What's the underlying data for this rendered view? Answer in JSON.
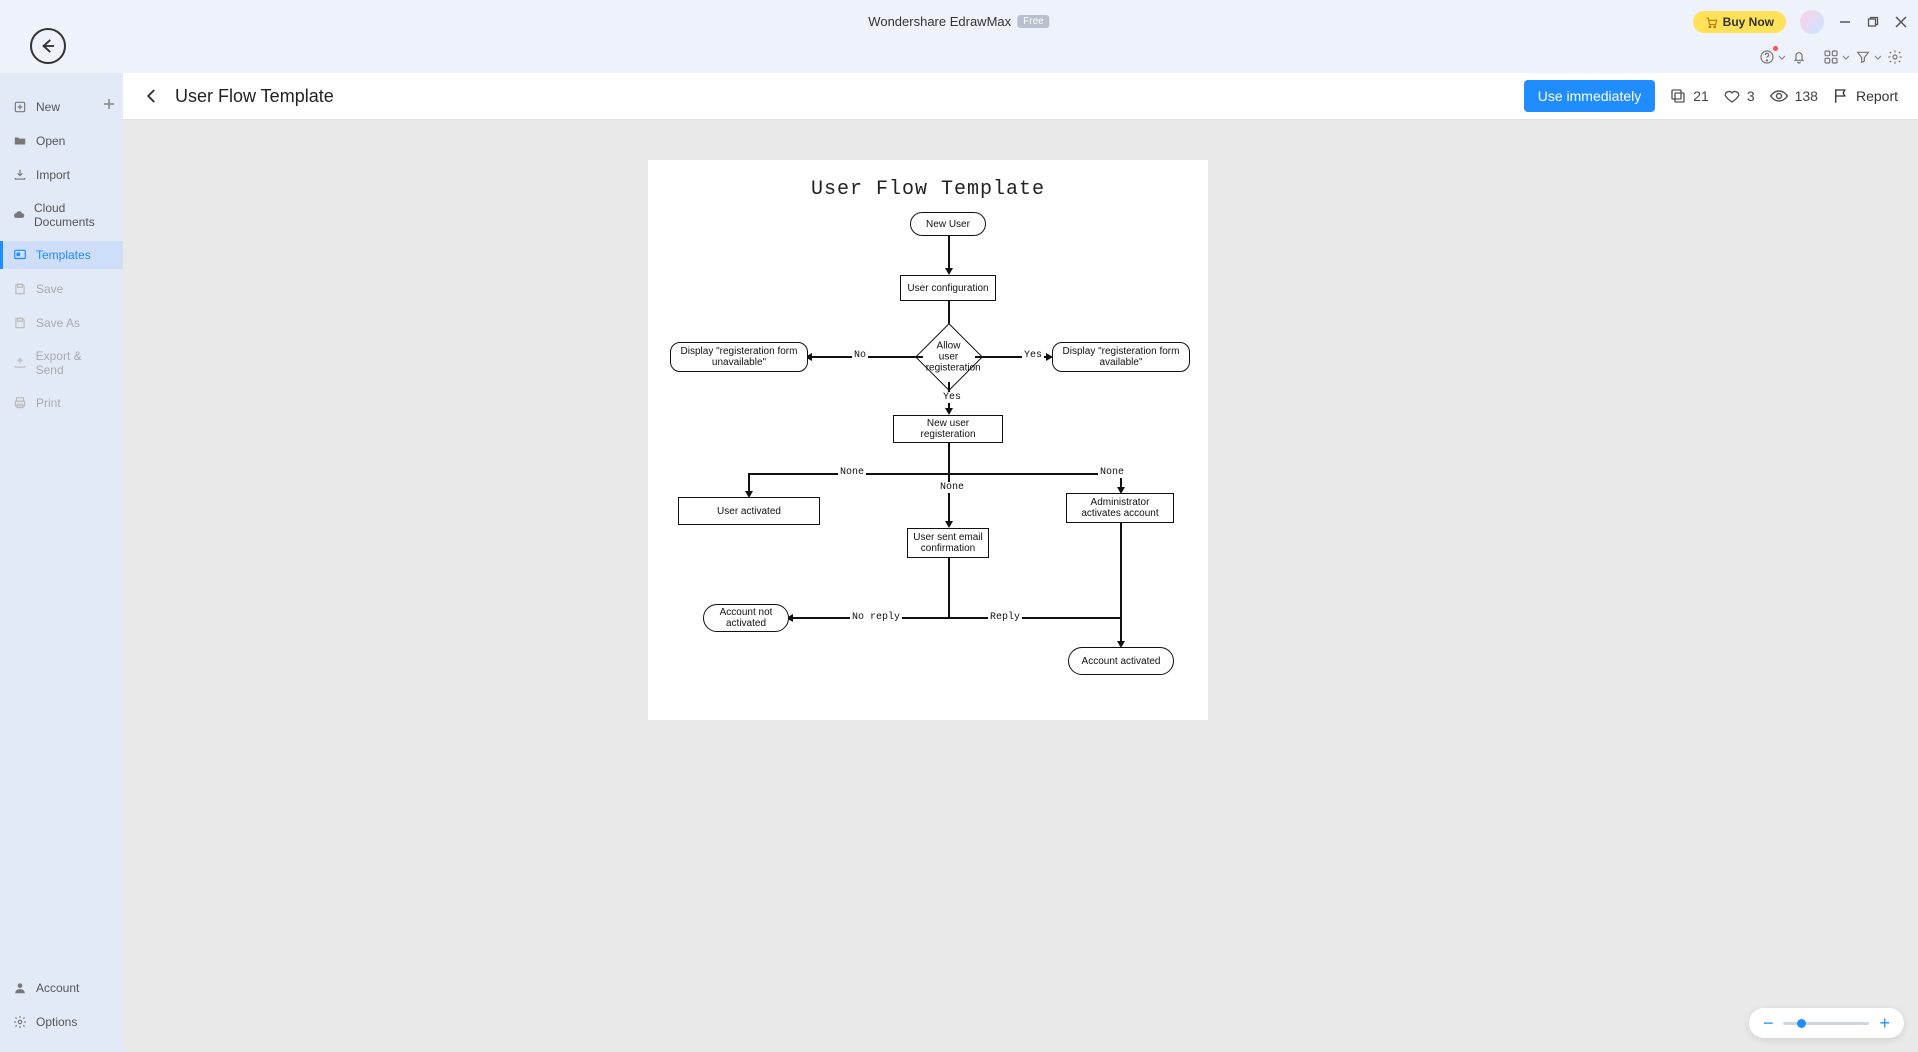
{
  "app": {
    "title": "Wondershare EdrawMax",
    "badge": "Free",
    "buy": "Buy Now"
  },
  "sidebar": {
    "items": [
      {
        "label": "New"
      },
      {
        "label": "Open"
      },
      {
        "label": "Import"
      },
      {
        "label": "Cloud Documents"
      },
      {
        "label": "Templates"
      },
      {
        "label": "Save"
      },
      {
        "label": "Save As"
      },
      {
        "label": "Export & Send"
      },
      {
        "label": "Print"
      }
    ],
    "bottom": [
      {
        "label": "Account"
      },
      {
        "label": "Options"
      }
    ]
  },
  "header": {
    "title": "User Flow Template",
    "use_label": "Use immediately",
    "copies": "21",
    "likes": "3",
    "views": "138",
    "report": "Report"
  },
  "diagram": {
    "title": "User Flow Template",
    "new_user": "New User",
    "user_config": "User configuration",
    "allow": "Allow user registeration",
    "display_unavail": "Display \"registeration form unavailable\"",
    "display_avail": "Display \"registeration form available\"",
    "new_reg": "New user registeration",
    "user_activated_left": "User activated",
    "admin_activates": "Administrator activates account",
    "email_conf": "User sent email confirmation",
    "acct_not_activated": "Account not activated",
    "acct_activated": "Account activated",
    "lbl_no": "No",
    "lbl_yes": "Yes",
    "lbl_yes2": "Yes",
    "lbl_none": "None",
    "lbl_none2": "None",
    "lbl_none3": "None",
    "lbl_noreply": "No reply",
    "lbl_reply": "Reply"
  }
}
